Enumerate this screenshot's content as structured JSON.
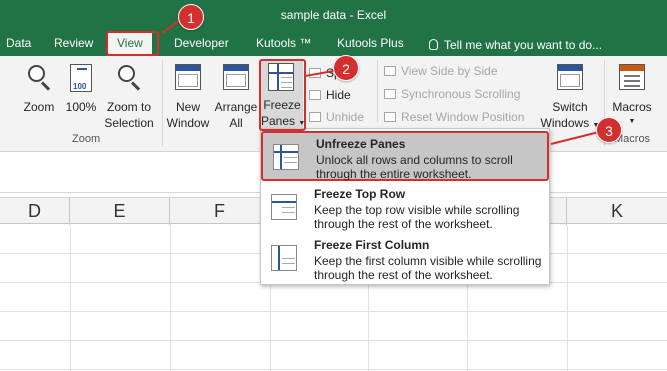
{
  "window": {
    "title": "sample data - Excel"
  },
  "tabs": [
    {
      "label": "Data"
    },
    {
      "label": "Review"
    },
    {
      "label": "View"
    },
    {
      "label": "Developer"
    },
    {
      "label": "Kutools ™"
    },
    {
      "label": "Kutools Plus"
    }
  ],
  "tell_me": "Tell me what you want to do...",
  "ribbon": {
    "zoom_group": {
      "label": "Zoom",
      "zoom": "Zoom",
      "hundred": "100%",
      "zoom_selection_1": "Zoom to",
      "zoom_selection_2": "Selection"
    },
    "window_group": {
      "new_window_1": "New",
      "new_window_2": "Window",
      "arrange_all_1": "Arrange",
      "arrange_all_2": "All",
      "freeze_panes_1": "Freeze",
      "freeze_panes_2": "Panes",
      "split": "Split",
      "hide": "Hide",
      "unhide": "Unhide",
      "view_side_by_side": "View Side by Side",
      "sync_scrolling": "Synchronous Scrolling",
      "reset_window_position": "Reset Window Position",
      "switch_windows_1": "Switch",
      "switch_windows_2": "Windows"
    },
    "macros_group": {
      "label": "Macros",
      "macros": "Macros"
    }
  },
  "freeze_menu": [
    {
      "title": "Unfreeze Panes",
      "desc": "Unlock all rows and columns to scroll through the entire worksheet."
    },
    {
      "title": "Freeze Top Row",
      "desc": "Keep the top row visible while scrolling through the rest of the worksheet."
    },
    {
      "title": "Freeze First Column",
      "desc": "Keep the first column visible while scrolling through the rest of the worksheet."
    }
  ],
  "columns": [
    "D",
    "E",
    "F",
    "K"
  ],
  "callouts": [
    "1",
    "2",
    "3"
  ],
  "colors": {
    "excel_green": "#217346",
    "callout_red": "#d32f2f",
    "menu_highlight": "#c6c6c6"
  }
}
